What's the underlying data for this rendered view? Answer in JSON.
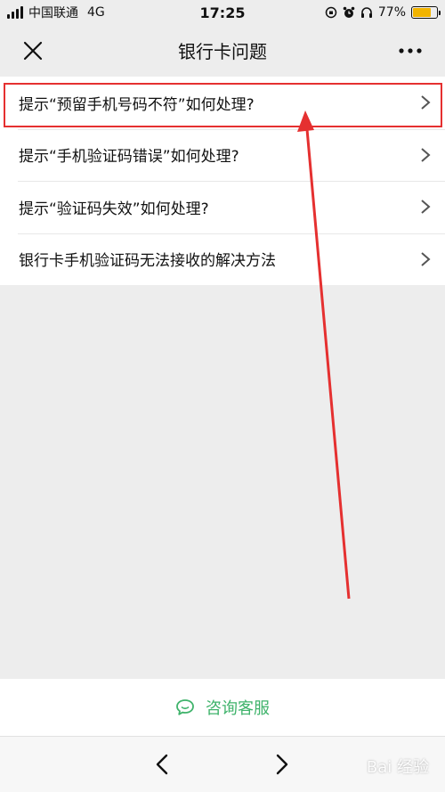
{
  "status_bar": {
    "carrier": "中国联通",
    "network": "4G",
    "time": "17:25",
    "battery_text": "77%",
    "battery_level": 0.77
  },
  "nav": {
    "title": "银行卡问题",
    "close_icon": "close-icon",
    "more_icon": "more-dots-icon"
  },
  "list": {
    "items": [
      {
        "label": "提示“预留手机号码不符”如何处理?"
      },
      {
        "label": "提示“手机验证码错误”如何处理?"
      },
      {
        "label": "提示“验证码失效”如何处理?"
      },
      {
        "label": "银行卡手机验证码无法接收的解决方法"
      }
    ]
  },
  "footer": {
    "consult_label": "咨询客服",
    "consult_icon": "chat-bubble-icon"
  },
  "toolbar": {
    "back_icon": "chevron-left-icon",
    "forward_icon": "chevron-right-icon"
  },
  "watermark": {
    "text": "Bai 经验"
  },
  "colors": {
    "accent": "#3fb36b",
    "highlight": "#e53030",
    "battery": "#f2b400"
  }
}
